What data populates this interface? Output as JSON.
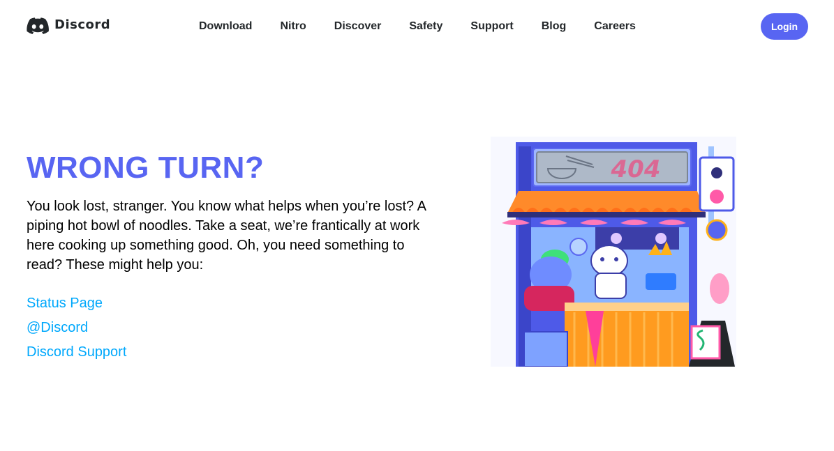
{
  "header": {
    "brand": "Discord",
    "logo_icon": "discord-logo-icon",
    "nav": [
      {
        "label": "Download"
      },
      {
        "label": "Nitro"
      },
      {
        "label": "Discover"
      },
      {
        "label": "Safety"
      },
      {
        "label": "Support"
      },
      {
        "label": "Blog"
      },
      {
        "label": "Careers"
      }
    ],
    "login_label": "Login"
  },
  "main": {
    "title": "WRONG TURN?",
    "body": "You look lost, stranger. You know what helps when you’re lost? A piping hot bowl of noodles. Take a seat, we’re frantically at work here cooking up something good. Oh, you need something to read? These might help you:",
    "links": [
      {
        "label": "Status Page"
      },
      {
        "label": "@Discord"
      },
      {
        "label": "Discord Support"
      }
    ]
  },
  "illustration": {
    "sign_text": "404"
  },
  "colors": {
    "brand": "#5865f2",
    "link": "#00a8fc",
    "text": "#23272a"
  }
}
